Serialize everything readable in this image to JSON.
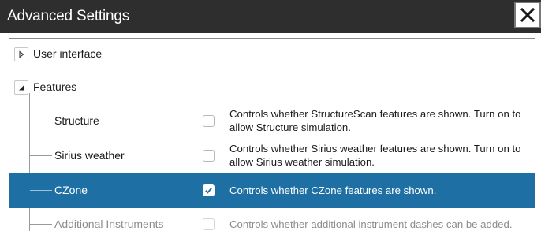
{
  "window": {
    "title": "Advanced Settings",
    "close_icon": "close-icon"
  },
  "tree": {
    "nodes": [
      {
        "label": "User interface",
        "state": "collapsed",
        "icon": "triangle-right-icon"
      },
      {
        "label": "Features",
        "state": "expanded",
        "icon": "triangle-down-icon"
      }
    ],
    "features": [
      {
        "label": "Structure",
        "checked": false,
        "description": "Controls whether StructureScan features are shown. Turn on to allow Structure simulation."
      },
      {
        "label": "Sirius weather",
        "checked": false,
        "description": "Controls whether Sirius weather features are shown. Turn on to allow Sirius weather simulation."
      },
      {
        "label": "CZone",
        "checked": true,
        "selected": true,
        "description": "Controls whether CZone features are shown."
      },
      {
        "label": "Additional Instruments",
        "checked": false,
        "description": "Controls whether additional instrument dashes can be added."
      }
    ]
  },
  "colors": {
    "titlebar": "#2e2e2e",
    "selection": "#1e6fa3"
  }
}
